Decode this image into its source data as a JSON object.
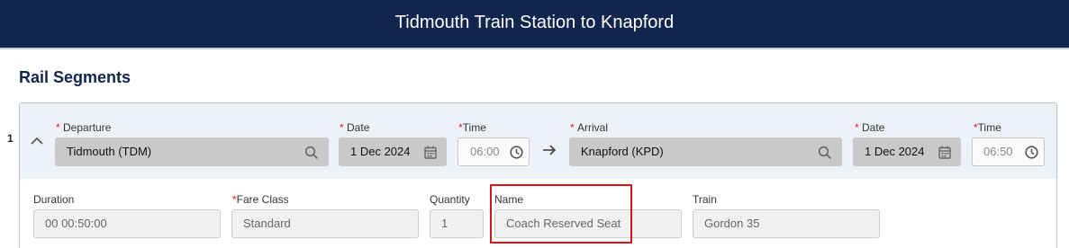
{
  "header": {
    "title": "Tidmouth Train Station to Knapford"
  },
  "section": {
    "title": "Rail Segments"
  },
  "segment": {
    "number": "1",
    "departure": {
      "label": "Departure",
      "value": "Tidmouth (TDM)"
    },
    "departure_date": {
      "label": "Date",
      "value": "1 Dec 2024"
    },
    "departure_time": {
      "label": "Time",
      "value": "06:00"
    },
    "arrival": {
      "label": "Arrival",
      "value": "Knapford (KPD)"
    },
    "arrival_date": {
      "label": "Date",
      "value": "1 Dec 2024"
    },
    "arrival_time": {
      "label": "Time",
      "value": "06:50"
    },
    "required_marker": "*",
    "details": {
      "duration": {
        "label": "Duration",
        "value": "00 00:50:00"
      },
      "fare_class": {
        "label": "Fare Class",
        "value": "Standard"
      },
      "quantity": {
        "label": "Quantity",
        "value": "1"
      },
      "name": {
        "label": "Name",
        "value": "Coach Reserved Seat"
      },
      "train": {
        "label": "Train",
        "value": "Gordon 35"
      }
    }
  },
  "colors": {
    "header_bg": "#10264f",
    "required": "#d8232a",
    "highlight": "#d9141b"
  },
  "icons": [
    "chevron-up-icon",
    "search-icon",
    "calendar-icon",
    "clock-icon",
    "arrow-right-icon"
  ]
}
